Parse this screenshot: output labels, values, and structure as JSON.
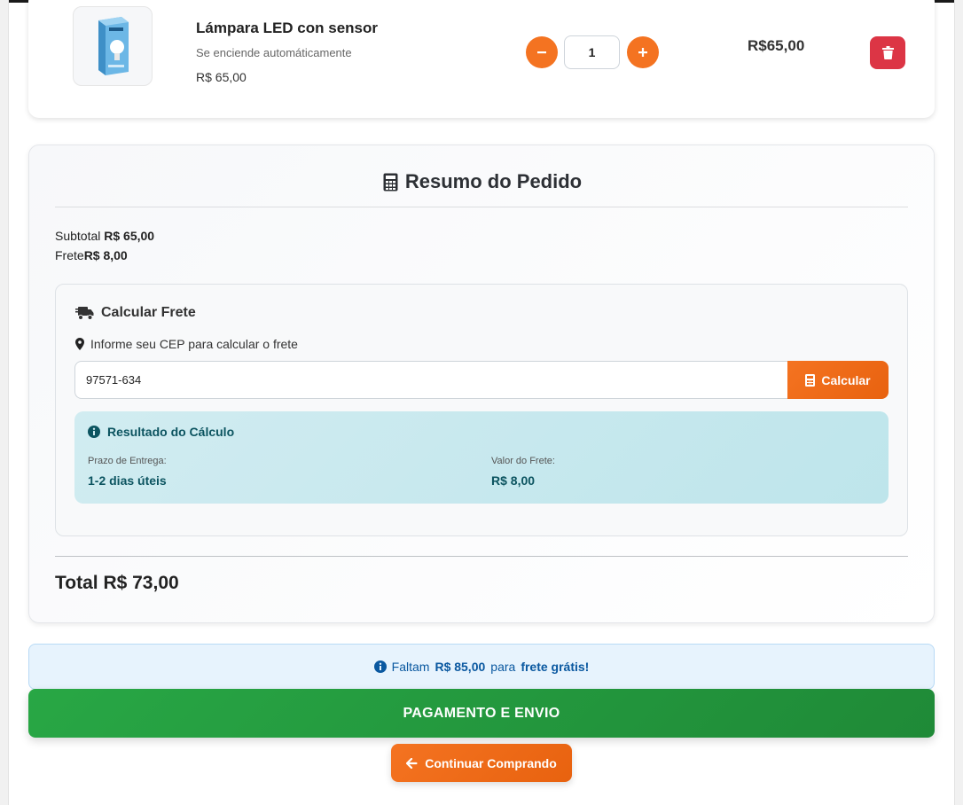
{
  "item": {
    "name": "Lámpara LED con sensor",
    "description": "Se enciende automáticamente",
    "unit_price": "R$ 65,00",
    "quantity": "1",
    "line_total": "R$65,00",
    "image_icon": "led-bulb-box-image"
  },
  "summary": {
    "title": "Resumo do Pedido",
    "subtotal_label": "Subtotal",
    "subtotal_value": "R$ 65,00",
    "frete_label": "Frete",
    "frete_value": "R$ 8,00",
    "total_label": "Total",
    "total_value": "R$ 73,00"
  },
  "shipping_calc": {
    "title": "Calcular Frete",
    "hint": "Informe seu CEP para calcular o frete",
    "cep_value": "97571-634",
    "button_label": "Calcular",
    "result": {
      "title": "Resultado do Cálculo",
      "prazo_label": "Prazo de Entrega:",
      "prazo_value": "1-2 dias úteis",
      "valor_label": "Valor do Frete:",
      "valor_value": "R$ 8,00"
    }
  },
  "free_shipping": {
    "prefix": "Faltam",
    "amount": "R$ 85,00",
    "middle": "para",
    "target": "frete grátis!"
  },
  "actions": {
    "checkout_label": "PAGAMENTO E ENVIO",
    "continue_label": "Continuar Comprando"
  },
  "colors": {
    "accent_orange": "#f47321",
    "danger_red": "#dc3545",
    "success_green": "#28a745",
    "info_teal": "#0c5460",
    "info_blue": "#0a58a0"
  }
}
